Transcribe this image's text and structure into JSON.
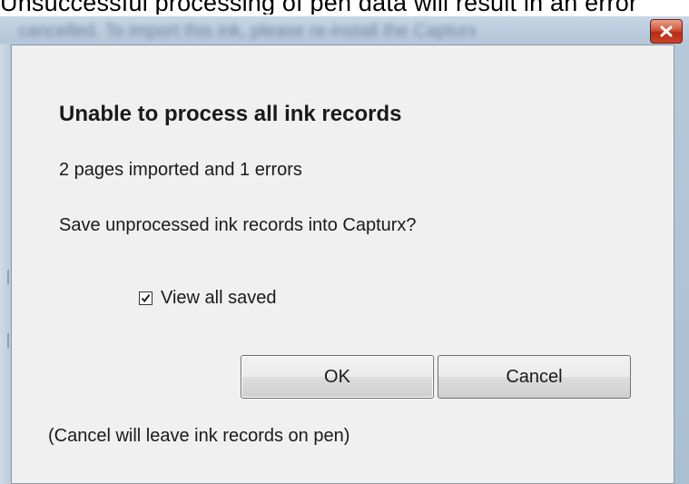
{
  "background_text": "Unsuccessful processing of pen data will result in an error",
  "window": {
    "title_blurred": "cancelled. To import this ink, please re-install the Capturx",
    "close_icon": "close-icon",
    "close_color": "#c9432a"
  },
  "dialog": {
    "heading": "Unable to process all ink records",
    "status": "2 pages imported and 1 errors",
    "question": "Save unprocessed ink records into Capturx?",
    "checkbox": {
      "label": "View all saved",
      "checked": true
    },
    "ok_label": "OK",
    "cancel_label": "Cancel",
    "note": "(Cancel will leave ink records on pen)"
  }
}
